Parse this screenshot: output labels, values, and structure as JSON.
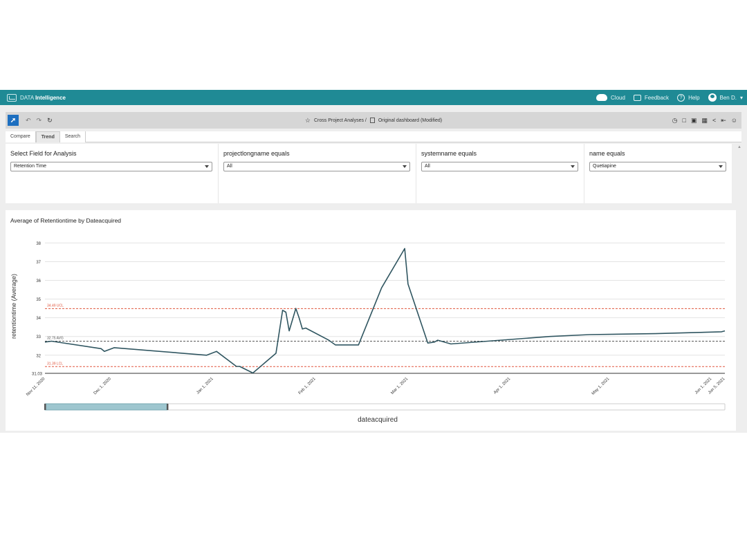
{
  "app": {
    "brand_prefix": "DATA",
    "brand_name": "Intelligence",
    "cloud_label": "Cloud",
    "feedback_label": "Feedback",
    "help_label": "Help",
    "user_label": "Ben D."
  },
  "toolbar": {
    "breadcrumb": "Cross Project Analyses /",
    "dashboard": "Original dashboard (Modified)"
  },
  "tabs": [
    {
      "label": "Compare",
      "active": false
    },
    {
      "label": "Trend",
      "active": true
    },
    {
      "label": "Search",
      "active": false
    }
  ],
  "filters": [
    {
      "label": "Select Field for Analysis",
      "value": "Retention Time"
    },
    {
      "label": "projectlongname equals",
      "value": "All"
    },
    {
      "label": "systemname equals",
      "value": "All"
    },
    {
      "label": "name equals",
      "value": "Quetiapine"
    }
  ],
  "chart_data": {
    "type": "line",
    "title": "Average of Retentiontime by Dateacquired",
    "xlabel": "dateacquired",
    "ylabel": "retentiontime (Average)",
    "ylim": [
      31.03,
      38.2
    ],
    "yticks": [
      32,
      33,
      34,
      35,
      36,
      37,
      38
    ],
    "ymin_label": "31.03",
    "xlim": [
      "2020-11-11",
      "2021-06-05"
    ],
    "xticks": [
      {
        "date": "2020-11-11",
        "label": "Nov 11, 2020"
      },
      {
        "date": "2020-12-01",
        "label": "Dec 1, 2020"
      },
      {
        "date": "2021-01-01",
        "label": "Jan 1, 2021"
      },
      {
        "date": "2021-02-01",
        "label": "Feb 1, 2021"
      },
      {
        "date": "2021-03-01",
        "label": "Mar 1, 2021"
      },
      {
        "date": "2021-04-01",
        "label": "Apr 1, 2021"
      },
      {
        "date": "2021-05-01",
        "label": "May 1, 2021"
      },
      {
        "date": "2021-06-01",
        "label": "Jun 1, 2021"
      },
      {
        "date": "2021-06-05",
        "label": "Jun 5, 2021"
      }
    ],
    "reference_lines": [
      {
        "value": 34.49,
        "label": "34.49 UCL",
        "color": "#e0553d",
        "style": "dashed"
      },
      {
        "value": 32.75,
        "label": "32.75 AVG",
        "color": "#555555",
        "style": "dashed"
      },
      {
        "value": 31.39,
        "label": "31.39 LCL",
        "color": "#e0553d",
        "style": "dashed"
      }
    ],
    "series": [
      {
        "color": "#2f5560",
        "points": [
          [
            "2020-11-11",
            32.7
          ],
          [
            "2020-11-13",
            32.75
          ],
          [
            "2020-11-28",
            32.35
          ],
          [
            "2020-11-29",
            32.2
          ],
          [
            "2020-12-02",
            32.4
          ],
          [
            "2020-12-30",
            32.0
          ],
          [
            "2021-01-02",
            32.2
          ],
          [
            "2021-01-08",
            31.4
          ],
          [
            "2021-01-09",
            31.4
          ],
          [
            "2021-01-13",
            31.05
          ],
          [
            "2021-01-20",
            32.1
          ],
          [
            "2021-01-22",
            34.4
          ],
          [
            "2021-01-23",
            34.3
          ],
          [
            "2021-01-24",
            33.3
          ],
          [
            "2021-01-26",
            34.5
          ],
          [
            "2021-01-27",
            34.0
          ],
          [
            "2021-01-28",
            33.4
          ],
          [
            "2021-01-29",
            33.45
          ],
          [
            "2021-02-05",
            32.8
          ],
          [
            "2021-02-07",
            32.55
          ],
          [
            "2021-02-14",
            32.55
          ],
          [
            "2021-02-21",
            35.6
          ],
          [
            "2021-02-28",
            37.7
          ],
          [
            "2021-03-01",
            35.8
          ],
          [
            "2021-03-07",
            32.65
          ],
          [
            "2021-03-09",
            32.7
          ],
          [
            "2021-03-10",
            32.8
          ],
          [
            "2021-03-14",
            32.6
          ],
          [
            "2021-04-13",
            33.0
          ],
          [
            "2021-04-25",
            33.1
          ],
          [
            "2021-05-15",
            33.15
          ],
          [
            "2021-06-04",
            33.25
          ],
          [
            "2021-06-05",
            33.3
          ]
        ]
      }
    ],
    "grid": true,
    "range_slider": {
      "start_fraction": 0.0,
      "end_fraction": 0.18
    }
  }
}
